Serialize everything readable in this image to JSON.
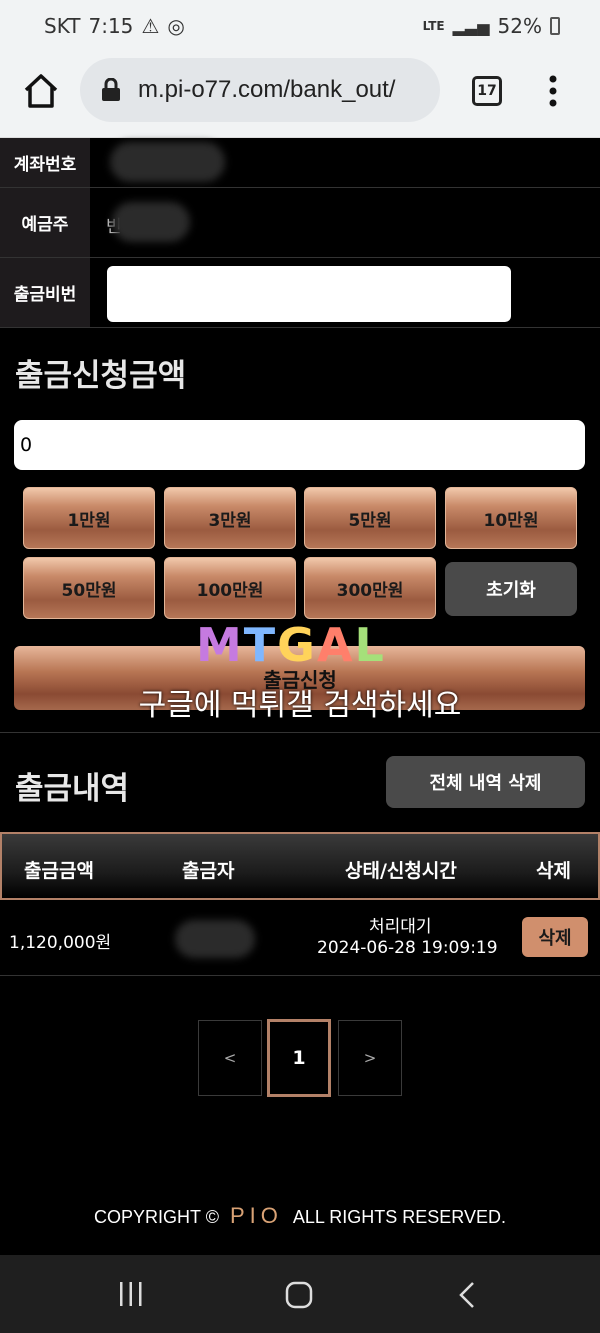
{
  "status": {
    "carrier": "SKT",
    "time": "7:15",
    "network": "LTE",
    "battery": "52%"
  },
  "browser": {
    "url": "m.pi-o77.com/bank_out/",
    "tabs_count": "17"
  },
  "form": {
    "account_number_label": "계좌번호",
    "account_holder_label": "예금주",
    "account_holder_value": "빈",
    "withdraw_password_label": "출금비번"
  },
  "amount_section": {
    "title": "출금신청금액",
    "amount_value": "0",
    "buttons": [
      "1만원",
      "3만원",
      "5만원",
      "10만원",
      "50만원",
      "100만원",
      "300만원"
    ],
    "reset_label": "초기화",
    "submit_label": "출금신청"
  },
  "watermark": {
    "logo": "MTGAL",
    "text": "구글에 먹튀갤 검색하세요"
  },
  "history": {
    "title": "출금내역",
    "delete_all_label": "전체 내역 삭제",
    "columns": [
      "출금금액",
      "출금자",
      "상태/신청시간",
      "삭제"
    ],
    "rows": [
      {
        "amount": "1,120,000원",
        "withdrawer": "",
        "status": "처리대기",
        "time": "2024-06-28 19:09:19",
        "delete_label": "삭제"
      }
    ],
    "pagination": {
      "prev": "<",
      "current": "1",
      "next": ">"
    }
  },
  "footer": {
    "prefix": "COPYRIGHT ©",
    "brand": "PIO",
    "suffix": "ALL RIGHTS RESERVED."
  },
  "colors": {
    "accent": "#b38168",
    "button_bg": "#4a4a4a",
    "row_delete_bg": "#d08f6d"
  }
}
